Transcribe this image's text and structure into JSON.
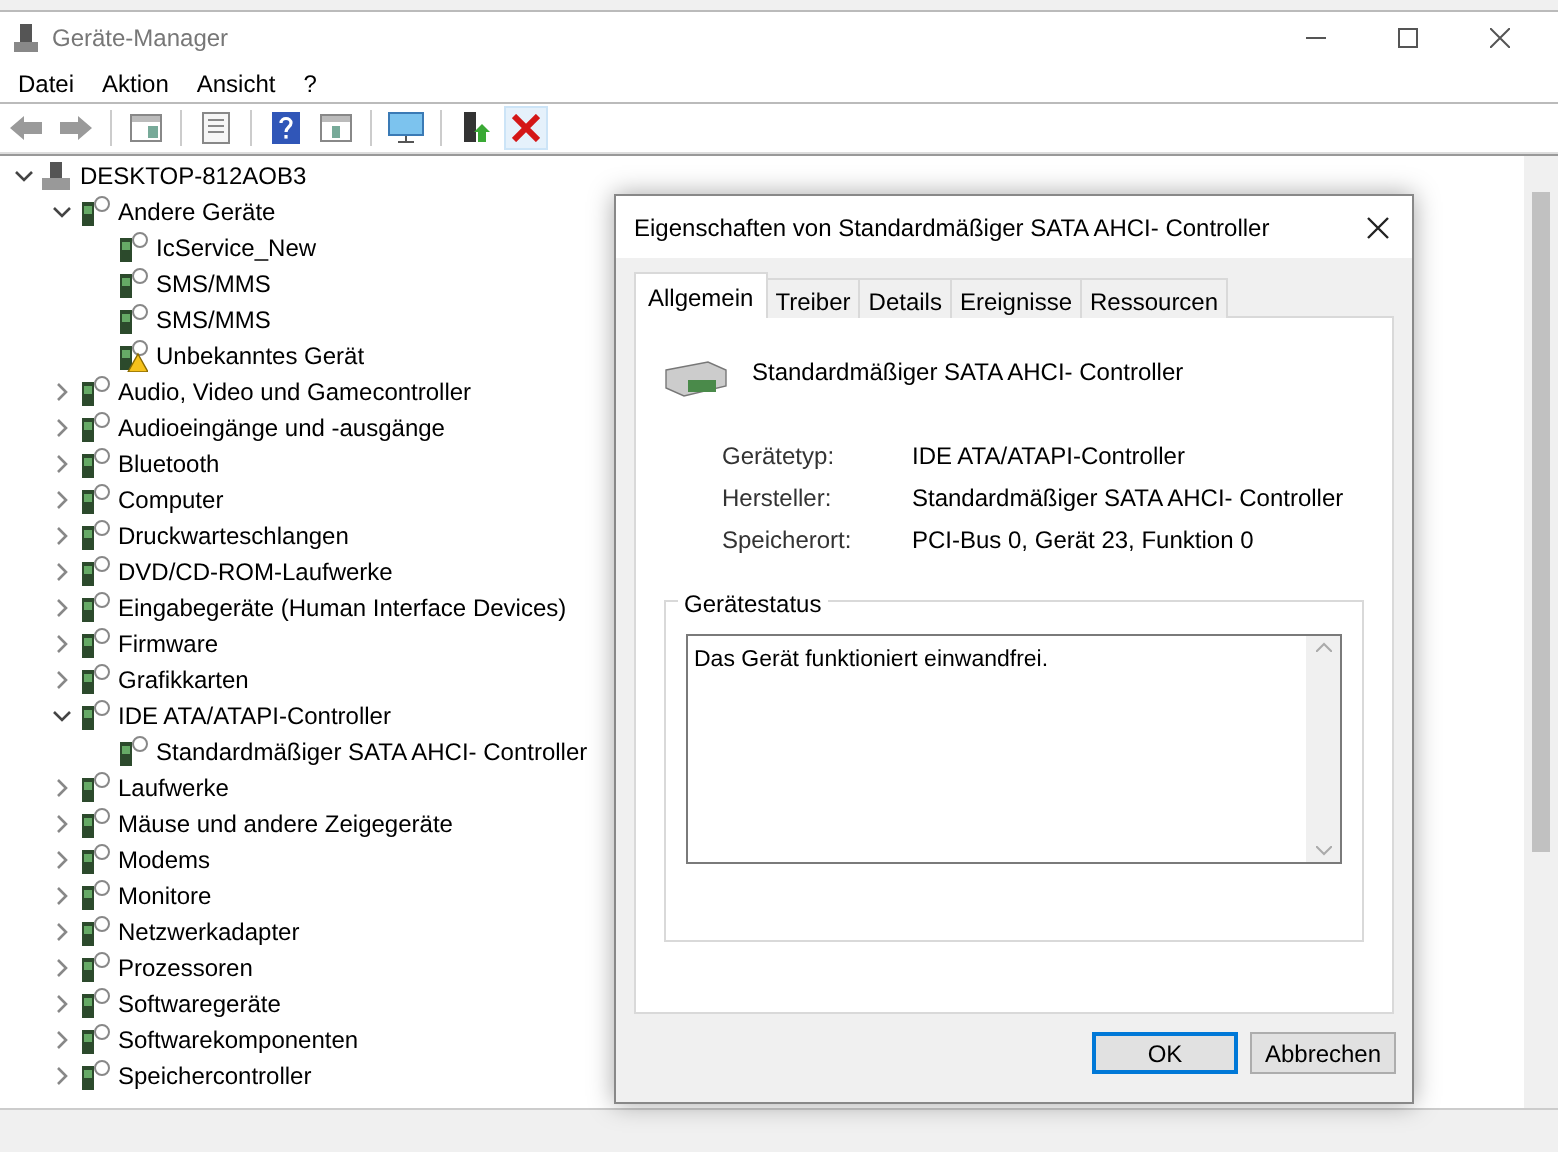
{
  "window": {
    "title": "Geräte-Manager"
  },
  "menu": [
    "Datei",
    "Aktion",
    "Ansicht",
    "?"
  ],
  "tree": {
    "label": "DESKTOP-812AOB3",
    "expanded": true,
    "children": [
      {
        "label": "Andere Geräte",
        "expanded": true,
        "children": [
          {
            "label": "IcService_New"
          },
          {
            "label": "SMS/MMS"
          },
          {
            "label": "SMS/MMS"
          },
          {
            "label": "Unbekanntes Gerät",
            "warning": true
          }
        ]
      },
      {
        "label": "Audio, Video und Gamecontroller",
        "expanded": false
      },
      {
        "label": "Audioeingänge und -ausgänge",
        "expanded": false
      },
      {
        "label": "Bluetooth",
        "expanded": false
      },
      {
        "label": "Computer",
        "expanded": false
      },
      {
        "label": "Druckwarteschlangen",
        "expanded": false
      },
      {
        "label": "DVD/CD-ROM-Laufwerke",
        "expanded": false
      },
      {
        "label": "Eingabegeräte (Human Interface Devices)",
        "expanded": false
      },
      {
        "label": "Firmware",
        "expanded": false
      },
      {
        "label": "Grafikkarten",
        "expanded": false
      },
      {
        "label": "IDE ATA/ATAPI-Controller",
        "expanded": true,
        "children": [
          {
            "label": "Standardmäßiger SATA AHCI- Controller"
          }
        ]
      },
      {
        "label": "Laufwerke",
        "expanded": false
      },
      {
        "label": "Mäuse und andere Zeigegeräte",
        "expanded": false
      },
      {
        "label": "Modems",
        "expanded": false
      },
      {
        "label": "Monitore",
        "expanded": false
      },
      {
        "label": "Netzwerkadapter",
        "expanded": false
      },
      {
        "label": "Prozessoren",
        "expanded": false
      },
      {
        "label": "Softwaregeräte",
        "expanded": false
      },
      {
        "label": "Softwarekomponenten",
        "expanded": false
      },
      {
        "label": "Speichercontroller",
        "expanded": false
      }
    ]
  },
  "dialog": {
    "title": "Eigenschaften von Standardmäßiger SATA AHCI- Controller",
    "tabs": [
      {
        "label": "Allgemein",
        "selected": true
      },
      {
        "label": "Treiber",
        "selected": false
      },
      {
        "label": "Details",
        "selected": false
      },
      {
        "label": "Ereignisse",
        "selected": false
      },
      {
        "label": "Ressourcen",
        "selected": false
      }
    ],
    "device_name": "Standardmäßiger SATA AHCI- Controller",
    "properties": [
      {
        "label": "Gerätetyp:",
        "value": "IDE ATA/ATAPI-Controller"
      },
      {
        "label": "Hersteller:",
        "value": "Standardmäßiger SATA AHCI- Controller"
      },
      {
        "label": "Speicherort:",
        "value": "PCI-Bus 0, Gerät 23, Funktion 0"
      }
    ],
    "status_group": {
      "title": "Gerätestatus",
      "text": "Das Gerät funktioniert einwandfrei."
    },
    "buttons": [
      {
        "label": "OK",
        "default": true
      },
      {
        "label": "Abbrechen",
        "default": false
      }
    ]
  }
}
